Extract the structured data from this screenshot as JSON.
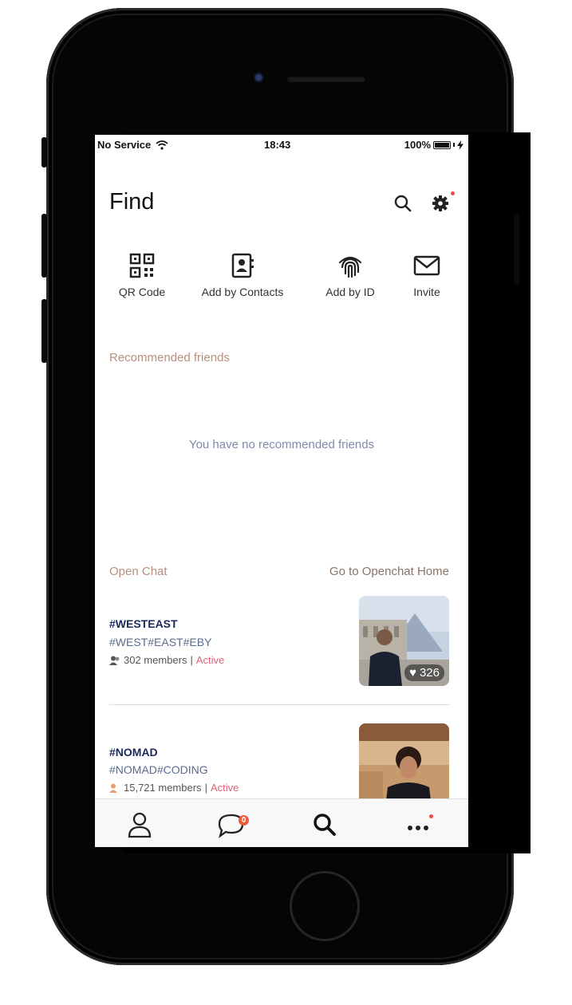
{
  "status_bar": {
    "carrier": "No Service",
    "time": "18:43",
    "battery": "100%"
  },
  "header": {
    "title": "Find"
  },
  "quick_actions": [
    {
      "label": "QR Code",
      "icon": "qr-code-icon"
    },
    {
      "label": "Add by Contacts",
      "icon": "contacts-book-icon"
    },
    {
      "label": "Add by ID",
      "icon": "fingerprint-icon"
    },
    {
      "label": "Invite",
      "icon": "envelope-icon"
    }
  ],
  "recommended": {
    "title": "Recommended friends",
    "empty_message": "You have no recommended friends"
  },
  "open_chat": {
    "title": "Open Chat",
    "link": "Go to Openchat Home",
    "items": [
      {
        "name": "#WESTEAST",
        "description": "#WEST#EAST#EBY",
        "members": "302 members",
        "status": "Active",
        "likes": "326"
      },
      {
        "name": "#NOMAD",
        "description": "#NOMAD#CODING",
        "members": "15,721 members",
        "status": "Active"
      }
    ]
  },
  "tab_bar": {
    "chats_badge": "0"
  },
  "colors": {
    "accent": "#f24b4b",
    "section_label": "#b78f7a",
    "active": "#e0607a"
  }
}
